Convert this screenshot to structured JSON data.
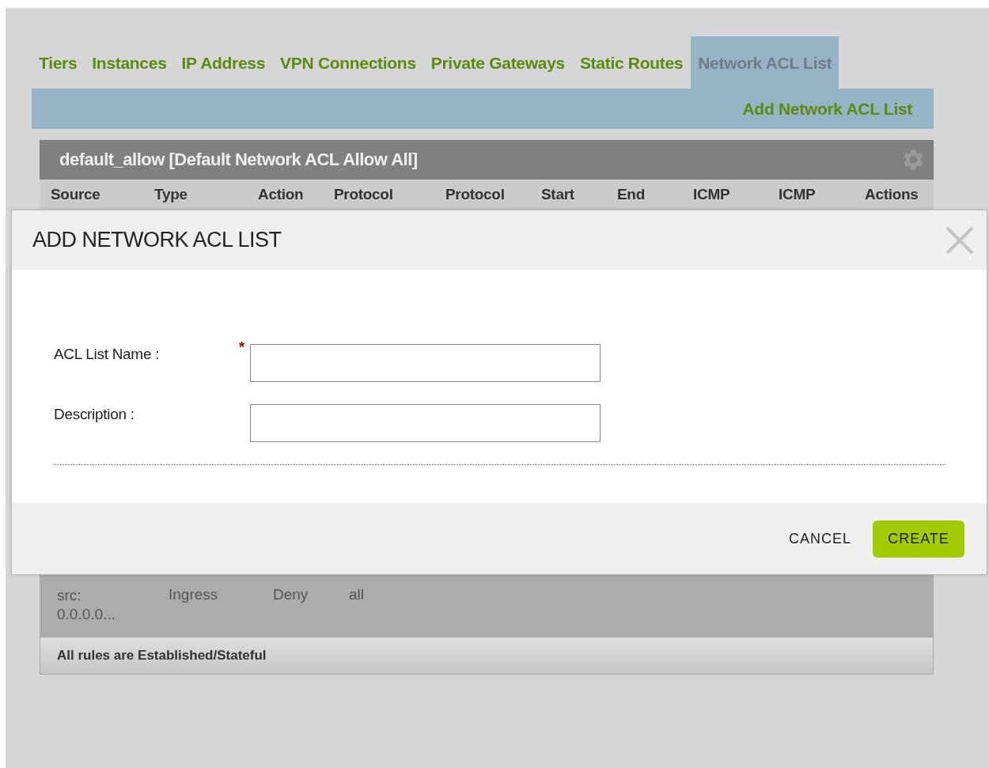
{
  "tabs": [
    {
      "label": "Tiers",
      "selected": false
    },
    {
      "label": "Instances",
      "selected": false
    },
    {
      "label": "IP Address",
      "selected": false
    },
    {
      "label": "VPN Connections",
      "selected": false
    },
    {
      "label": "Private Gateways",
      "selected": false
    },
    {
      "label": "Static Routes",
      "selected": false
    },
    {
      "label": "Network ACL List",
      "selected": true
    }
  ],
  "toolbar": {
    "action": "Add Network ACL List"
  },
  "acl_panel": {
    "title": "default_allow [Default Network ACL Allow All]",
    "columns": [
      "Source",
      "Type",
      "Action",
      "Protocol",
      "Protocol",
      "Start",
      "End",
      "ICMP",
      "ICMP",
      "Actions"
    ],
    "rows": [
      {
        "cells": [
          "src: 0.0.0.0...",
          "Ingress",
          "Deny",
          "all"
        ]
      }
    ],
    "footer_note": "All rules are Established/Stateful"
  },
  "dialog": {
    "title": "ADD NETWORK ACL LIST",
    "required_mark": "*",
    "fields": [
      {
        "label": "ACL List Name :",
        "required": true
      },
      {
        "label": "Description :",
        "required": false
      }
    ],
    "buttons": [
      {
        "label": "CANCEL",
        "kind": "secondary"
      },
      {
        "label": "CREATE",
        "kind": "primary"
      }
    ]
  }
}
